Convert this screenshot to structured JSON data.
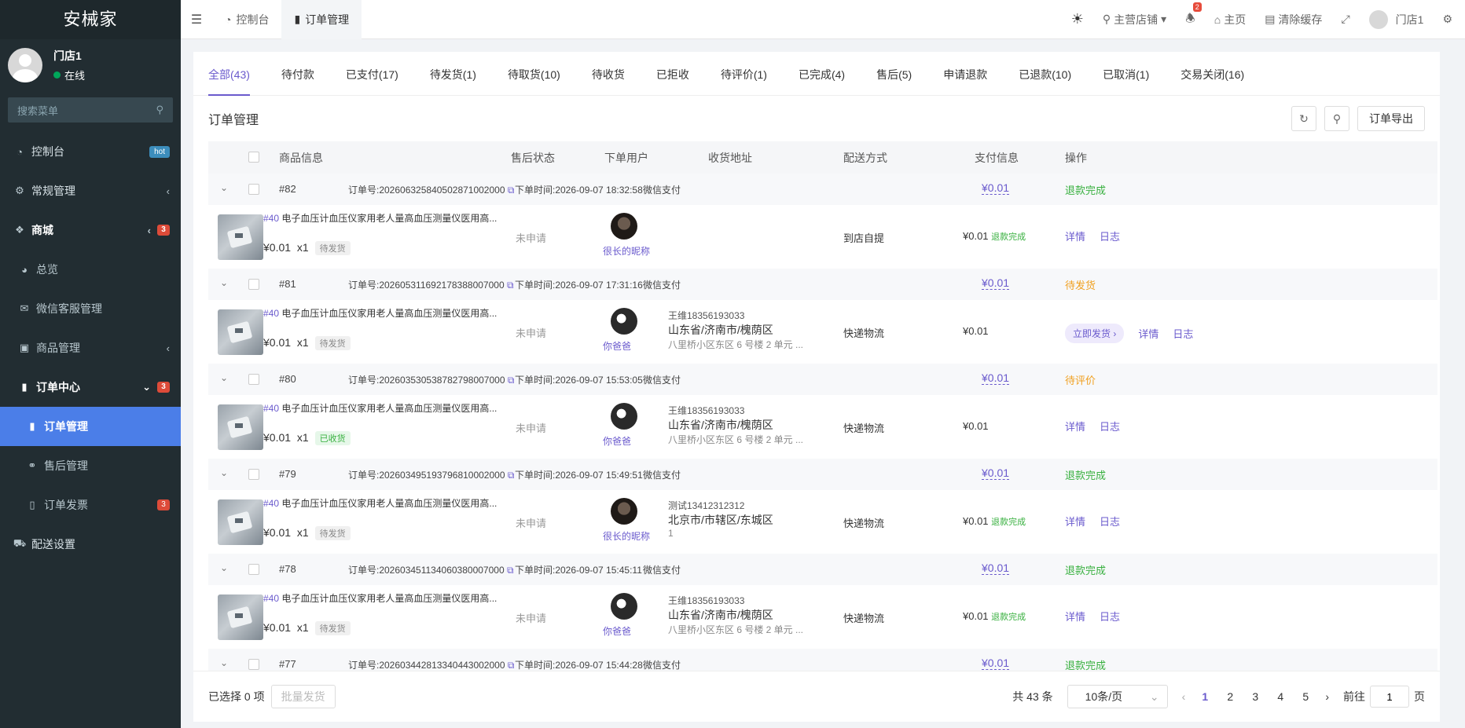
{
  "app": {
    "logo": "安械家"
  },
  "user": {
    "name": "门店1",
    "status": "在线"
  },
  "sidebar": {
    "search_placeholder": "搜索菜单",
    "items": [
      {
        "label": "控制台",
        "badge": "hot"
      },
      {
        "label": "常规管理"
      },
      {
        "label": "商城",
        "badge": "3"
      },
      {
        "label": "总览"
      },
      {
        "label": "微信客服管理"
      },
      {
        "label": "商品管理"
      },
      {
        "label": "订单中心",
        "badge": "3"
      },
      {
        "label": "订单管理"
      },
      {
        "label": "售后管理"
      },
      {
        "label": "订单发票",
        "badge": "3"
      },
      {
        "label": "配送设置"
      }
    ]
  },
  "topbar": {
    "tabs": [
      "控制台",
      "订单管理"
    ],
    "store": "主营店铺",
    "bell_count": "2",
    "home": "主页",
    "clear_cache": "清除缓存",
    "user": "门店1"
  },
  "status_tabs": [
    "全部(43)",
    "待付款",
    "已支付(17)",
    "待发货(1)",
    "待取货(10)",
    "待收货",
    "已拒收",
    "待评价(1)",
    "已完成(4)",
    "售后(5)",
    "申请退款",
    "已退款(10)",
    "已取消(1)",
    "交易关闭(16)"
  ],
  "section": {
    "title": "订单管理",
    "export": "订单导出"
  },
  "columns": [
    "商品信息",
    "售后状态",
    "下单用户",
    "收货地址",
    "配送方式",
    "支付信息",
    "操作"
  ],
  "orders": [
    {
      "num": "#82",
      "order_no": "订单号:20260632584050287100200​0",
      "time": "下单时间:2026-09-07 18:32:58",
      "pay_method": "微信支付",
      "pay_amount": "¥0.01",
      "status": "退款完成",
      "product_id": "#40",
      "product": "电子血压计血压仪家用老人量高血压测量仪医用高...",
      "price": "¥0.01",
      "qty": "x1",
      "ship_tag": "待发货",
      "aftersale": "未申请",
      "buyer": "很长的昵称",
      "addr_contact": "",
      "addr_region": "",
      "addr_detail": "",
      "delivery": "到店自提",
      "paid": "¥0.01",
      "paid_tag": "退款完成",
      "ship_btn": "",
      "op_detail": "详情",
      "op_log": "日志"
    },
    {
      "num": "#81",
      "order_no": "订单号:20260531169217838800700​0",
      "time": "下单时间:2026-09-07 17:31:16",
      "pay_method": "微信支付",
      "pay_amount": "¥0.01",
      "status": "待发货",
      "product_id": "#40",
      "product": "电子血压计血压仪家用老人量高血压测量仪医用高...",
      "price": "¥0.01",
      "qty": "x1",
      "ship_tag": "待发货",
      "aftersale": "未申请",
      "buyer": "你爸爸",
      "addr_contact": "王维18356193033",
      "addr_region": "山东省/济南市/槐荫区",
      "addr_detail": "八里桥小区东区 6 号楼 2 单元 ...",
      "delivery": "快递物流",
      "paid": "¥0.01",
      "paid_tag": "",
      "ship_btn": "立即发货 ›",
      "op_detail": "详情",
      "op_log": "日志"
    },
    {
      "num": "#80",
      "order_no": "订单号:20260353053878279800700​0",
      "time": "下单时间:2026-09-07 15:53:05",
      "pay_method": "微信支付",
      "pay_amount": "¥0.01",
      "status": "待评价",
      "product_id": "#40",
      "product": "电子血压计血压仪家用老人量高血压测量仪医用高...",
      "price": "¥0.01",
      "qty": "x1",
      "ship_tag": "已收货",
      "aftersale": "未申请",
      "buyer": "你爸爸",
      "addr_contact": "王维18356193033",
      "addr_region": "山东省/济南市/槐荫区",
      "addr_detail": "八里桥小区东区 6 号楼 2 单元 ...",
      "delivery": "快递物流",
      "paid": "¥0.01",
      "paid_tag": "",
      "ship_btn": "",
      "op_detail": "详情",
      "op_log": "日志"
    },
    {
      "num": "#79",
      "order_no": "订单号:20260349519379681000200​0",
      "time": "下单时间:2026-09-07 15:49:51",
      "pay_method": "微信支付",
      "pay_amount": "¥0.01",
      "status": "退款完成",
      "product_id": "#40",
      "product": "电子血压计血压仪家用老人量高血压测量仪医用高...",
      "price": "¥0.01",
      "qty": "x1",
      "ship_tag": "待发货",
      "aftersale": "未申请",
      "buyer": "很长的昵称",
      "addr_contact": "测试13412312312",
      "addr_region": "北京市/市辖区/东城区",
      "addr_detail": "1",
      "delivery": "快递物流",
      "paid": "¥0.01",
      "paid_tag": "退款完成",
      "ship_btn": "",
      "op_detail": "详情",
      "op_log": "日志"
    },
    {
      "num": "#78",
      "order_no": "订单号:20260345113406038000700​0",
      "time": "下单时间:2026-09-07 15:45:11",
      "pay_method": "微信支付",
      "pay_amount": "¥0.01",
      "status": "退款完成",
      "product_id": "#40",
      "product": "电子血压计血压仪家用老人量高血压测量仪医用高...",
      "price": "¥0.01",
      "qty": "x1",
      "ship_tag": "待发货",
      "aftersale": "未申请",
      "buyer": "你爸爸",
      "addr_contact": "王维18356193033",
      "addr_region": "山东省/济南市/槐荫区",
      "addr_detail": "八里桥小区东区 6 号楼 2 单元 ...",
      "delivery": "快递物流",
      "paid": "¥0.01",
      "paid_tag": "退款完成",
      "ship_btn": "",
      "op_detail": "详情",
      "op_log": "日志"
    },
    {
      "num": "#77",
      "order_no": "订单号:20260344281334044300200​0",
      "time": "下单时间:2026-09-07 15:44:28",
      "pay_method": "微信支付",
      "pay_amount": "¥0.01",
      "status": "退款完成"
    }
  ],
  "footer": {
    "selected": "已选择 0 项",
    "batch": "批量发货",
    "total": "共 43 条",
    "page_size": "10条/页",
    "pages": [
      "1",
      "2",
      "3",
      "4",
      "5"
    ],
    "goto_label": "前往",
    "goto_value": "1",
    "page_suffix": "页"
  }
}
